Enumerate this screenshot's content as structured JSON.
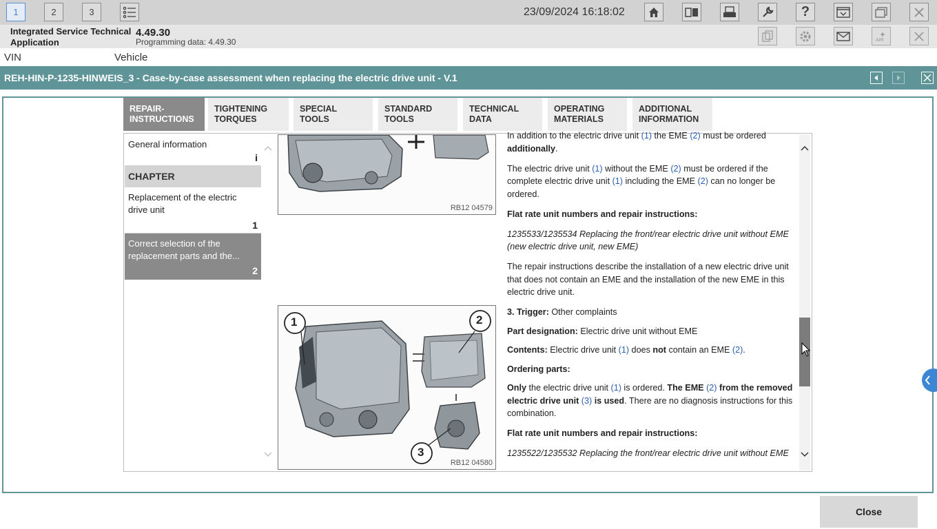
{
  "topbar": {
    "tabs": [
      "1",
      "2",
      "3"
    ],
    "datetime": "23/09/2024 16:18:02",
    "icons": [
      "list-icon",
      "home-icon",
      "split-view-icon",
      "print-icon",
      "wrench-icon",
      "help-icon",
      "dropdown-panel-icon",
      "window-icon",
      "close-icon"
    ]
  },
  "appbar": {
    "app_name": "Integrated Service Technical Application",
    "version": "4.49.30",
    "programming_label": "Programming data:  4.49.30"
  },
  "vinbar": {
    "vin": "VIN",
    "vehicle": "Vehicle"
  },
  "document": {
    "title": "REH-HIN-P-1235-HINWEIS_3 - Case-by-case assessment when replacing the electric drive unit - V.1"
  },
  "tabs": [
    {
      "line1": "REPAIR-",
      "line2": "INSTRUCTIONS",
      "active": true
    },
    {
      "line1": "TIGHTENING",
      "line2": "TORQUES",
      "active": false
    },
    {
      "line1": "SPECIAL TOOLS",
      "line2": "",
      "active": false
    },
    {
      "line1": "STANDARD",
      "line2": "TOOLS",
      "active": false
    },
    {
      "line1": "TECHNICAL",
      "line2": "DATA",
      "active": false
    },
    {
      "line1": "OPERATING",
      "line2": "MATERIALS",
      "active": false
    },
    {
      "line1": "ADDITIONAL",
      "line2": "INFORMATION",
      "active": false
    }
  ],
  "toc": {
    "general": "General information",
    "general_num": "i",
    "chapter": "CHAPTER",
    "item1": "Replacement of the electric drive unit",
    "item1_num": "1",
    "item2": "Correct selection of the replacement parts and the...",
    "item2_num": "2"
  },
  "figures": {
    "fig1": "RB12 04579",
    "fig2": "RB12 04580",
    "callout1": "1",
    "callout2": "2",
    "callout3": "3"
  },
  "text": {
    "p1a": "In addition to the electric drive unit ",
    "p1b": " the EME ",
    "p1c": " must be ordered ",
    "p1d": "additionally",
    "p2a": "The electric drive unit ",
    "p2b": " without the EME ",
    "p2c": " must be ordered if the complete electric drive unit ",
    "p2d": " including the EME ",
    "p2e": " can no longer be ordered.",
    "h_flat1": "Flat rate unit numbers and repair instructions:",
    "it1": "1235533/1235534 Replacing the front/rear electric drive unit without EME (new electric drive unit, new EME)",
    "p3": "The repair instructions describe the installation of a new electric drive unit that does not contain an EME and the installation of the new EME in this electric drive unit.",
    "trigger_label": "3. Trigger:",
    "trigger_val": " Other complaints",
    "part_label": "Part designation:",
    "part_val": " Electric drive unit without EME",
    "contents_label": "Contents:",
    "contents_a": " Electric drive unit ",
    "contents_b": " does ",
    "contents_not": "not",
    "contents_c": " contain an EME ",
    "ordering": "Ordering parts:",
    "p4_only": "Only",
    "p4a": " the electric drive unit ",
    "p4b": " is ordered. ",
    "p4c": "The EME ",
    "p4d": " from the removed electric drive unit ",
    "p4e": " is used",
    "p4f": ". There are no diagnosis instructions for this combination.",
    "h_flat2": "Flat rate unit numbers and repair instructions:",
    "it2": "1235522/1235532 Replacing the front/rear electric drive unit without EME",
    "ref1": "(1)",
    "ref2": "(2)",
    "ref3": "(3)"
  },
  "footer": {
    "close": "Close"
  }
}
